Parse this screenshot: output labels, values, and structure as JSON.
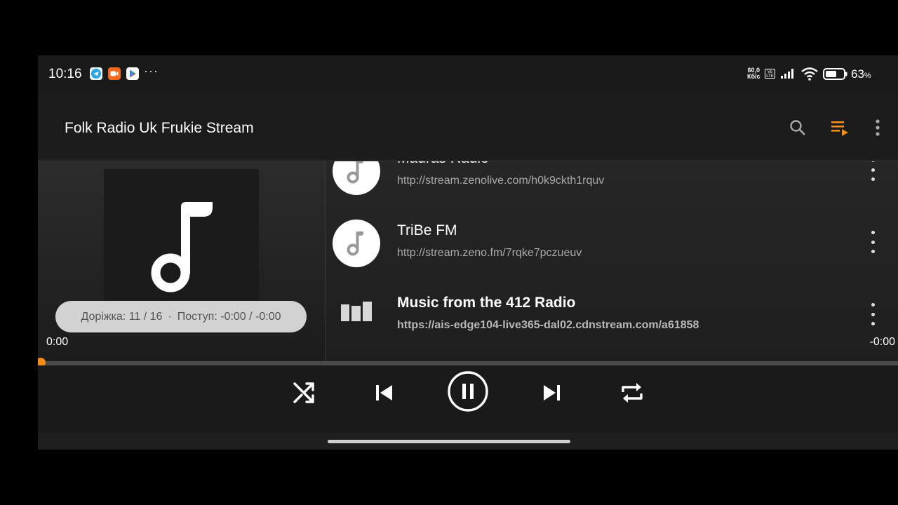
{
  "status_bar": {
    "time": "10:16",
    "more_notifications": "···",
    "net_speed_value": "60,0",
    "net_speed_unit": "Кб/с",
    "volte": "Vo LTE",
    "battery_percent": "63",
    "battery_level": 0.63
  },
  "app_bar": {
    "title": "Folk Radio Uk Frukie Stream",
    "icons": [
      "search-icon",
      "queue-music-icon",
      "more-vert-icon"
    ],
    "accent_color": "#f28c1b"
  },
  "now_playing": {
    "track_label": "Доріжка: 11 / 16",
    "separator": "·",
    "progress_label": "Поступ: -0:00 / -0:00",
    "time_current": "0:00",
    "time_remaining": "-0:00",
    "progress_fraction": 0.0
  },
  "queue": [
    {
      "name": "Madras Radio",
      "url": "http://stream.zenolive.com/h0k9ckth1rquv",
      "active": false
    },
    {
      "name": "TriBe FM",
      "url": "http://stream.zeno.fm/7rqke7pczueuv",
      "active": false
    },
    {
      "name": "Music from the 412 Radio",
      "url": "https://ais-edge104-live365-dal02.cdnstream.com/a61858",
      "active": true
    }
  ],
  "controls": [
    "shuffle-icon",
    "skip-previous-icon",
    "pause-icon",
    "skip-next-icon",
    "repeat-icon"
  ]
}
